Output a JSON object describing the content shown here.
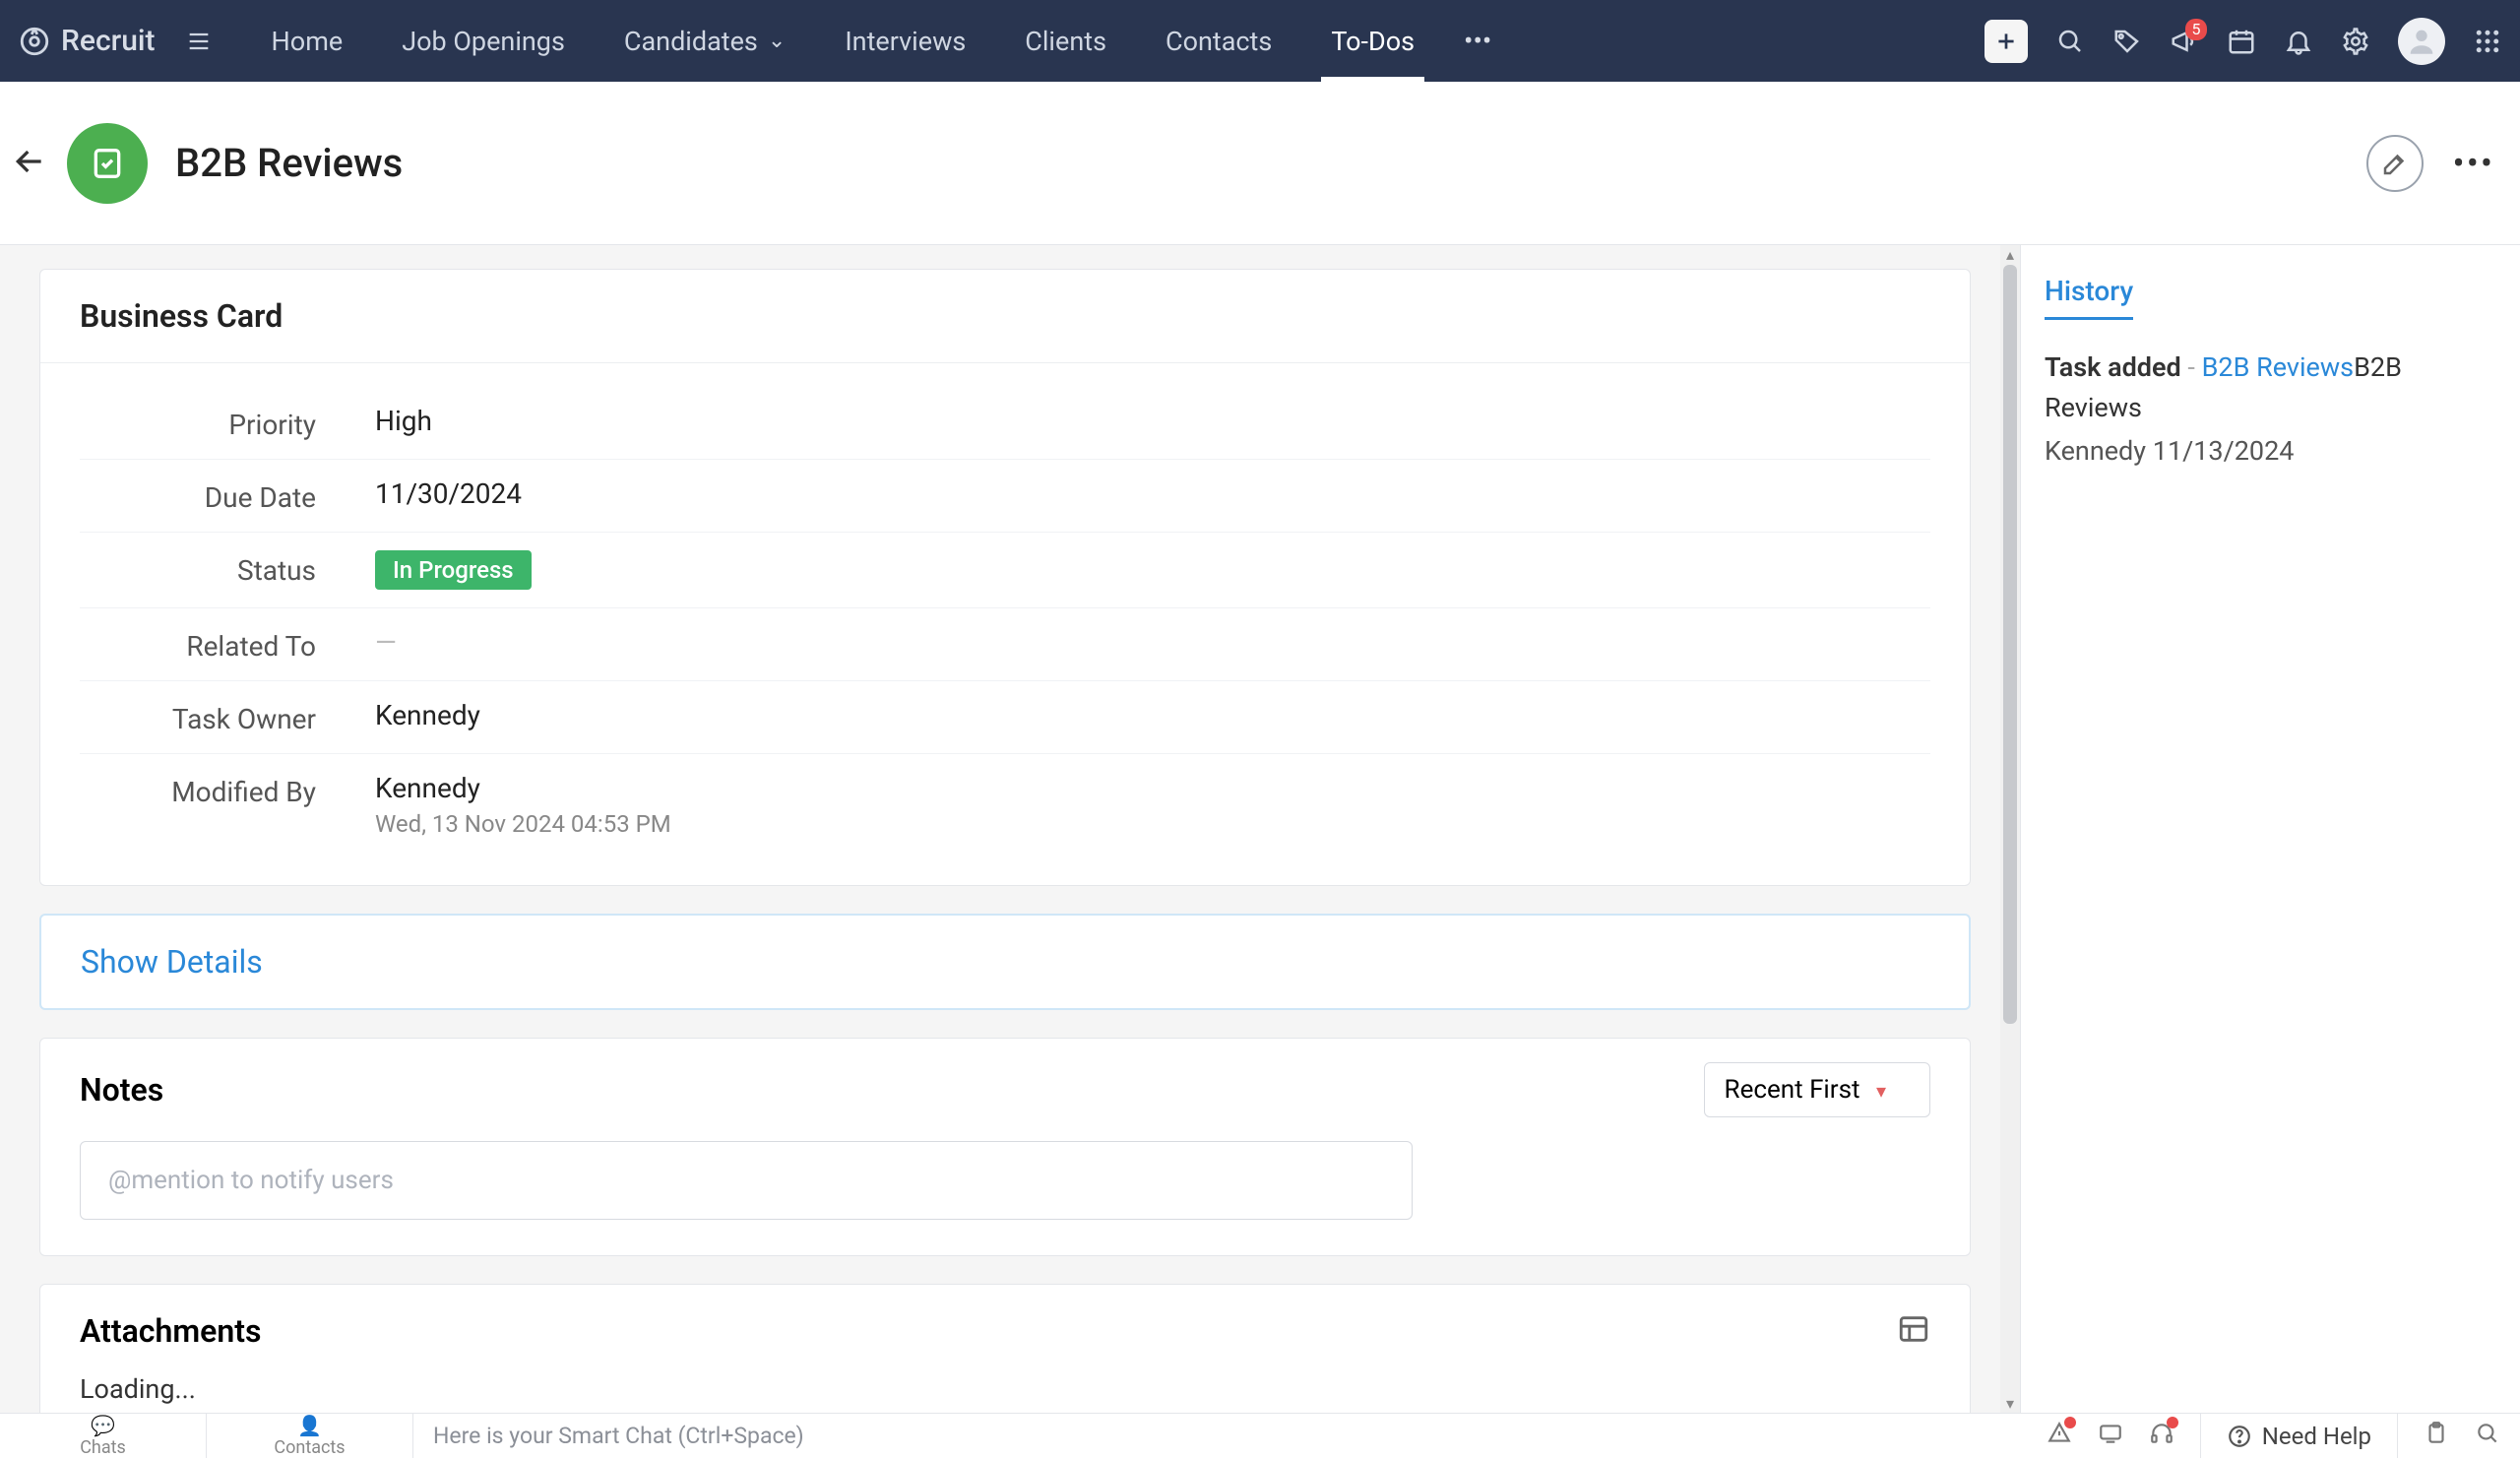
{
  "brand": "Recruit",
  "nav": {
    "items": [
      "Home",
      "Job Openings",
      "Candidates",
      "Interviews",
      "Clients",
      "Contacts",
      "To-Dos"
    ],
    "active_index": 6,
    "dropdown_index": 2
  },
  "notifications_badge": "5",
  "page": {
    "title": "B2B Reviews"
  },
  "business_card": {
    "heading": "Business Card",
    "labels": {
      "priority": "Priority",
      "due_date": "Due Date",
      "status": "Status",
      "related_to": "Related To",
      "task_owner": "Task Owner",
      "modified_by": "Modified By"
    },
    "values": {
      "priority": "High",
      "due_date": "11/30/2024",
      "status": "In Progress",
      "related_to": "—",
      "task_owner": "Kennedy",
      "modified_by_name": "Kennedy",
      "modified_by_time": "Wed, 13 Nov 2024 04:53 PM"
    }
  },
  "show_details_label": "Show Details",
  "notes": {
    "heading": "Notes",
    "sort_label": "Recent First",
    "placeholder": "@mention to notify users"
  },
  "attachments": {
    "heading": "Attachments",
    "loading": "Loading..."
  },
  "history": {
    "tab": "History",
    "action": "Task added",
    "link_text": "B2B Reviews",
    "trailing": "B2B Reviews",
    "user": "Kennedy",
    "date": "11/13/2024"
  },
  "bottombar": {
    "chats": "Chats",
    "contacts": "Contacts",
    "smart_chat": "Here is your Smart Chat (Ctrl+Space)",
    "need_help": "Need Help"
  }
}
